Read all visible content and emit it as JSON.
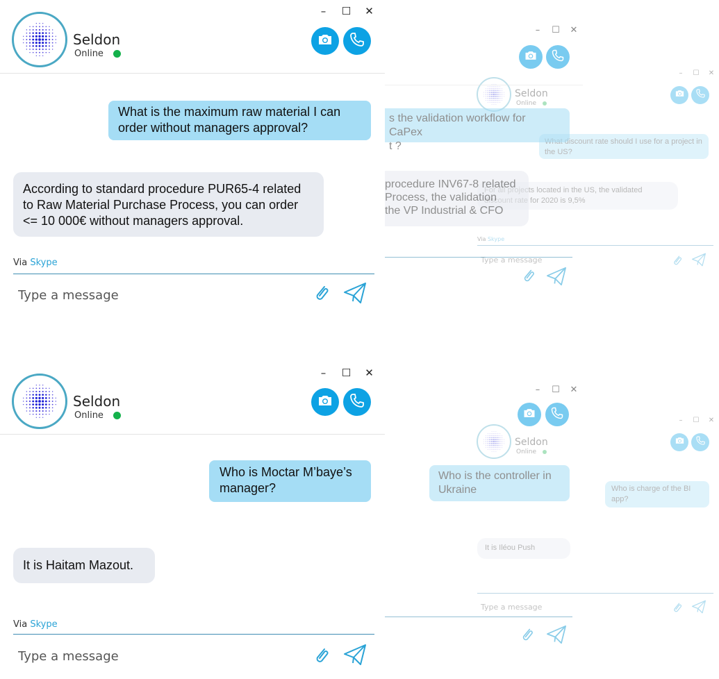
{
  "window_controls": {
    "minimize": "–",
    "maximize": "☐",
    "close": "✕"
  },
  "bot": {
    "name": "Seldon",
    "status": "Online"
  },
  "colors": {
    "call_button": "#0da2e4",
    "user_bubble": "#a5ddf5",
    "bot_bubble": "#e8ebf1",
    "online_dot": "#14b14b",
    "link": "#2aa3d6"
  },
  "icons": {
    "camera": "camera-icon",
    "phone": "phone-icon",
    "attach": "paperclip-icon",
    "send": "paper-plane-icon"
  },
  "via": {
    "prefix": "Via",
    "service": "Skype"
  },
  "input": {
    "placeholder": "Type a message"
  },
  "windows": [
    {
      "user_message": "What is the maximum raw material I can order without managers approval?",
      "bot_message": "According to standard procedure PUR65-4 related to Raw Material Purchase Process, you can order <= 10 000€ without managers approval."
    },
    {
      "user_message": "Who is Moctar M’baye’s manager?",
      "bot_message": "It is Haitam Mazout."
    }
  ],
  "background_windows": [
    {
      "user_message_fragment": "s the validation workflow for CaPex",
      "user_message_fragment2": "t ?",
      "bot_message_fragment1": "procedure INV67-8 related",
      "bot_message_fragment2": "Process, the validation",
      "bot_message_fragment3": "the VP Industrial & CFO"
    },
    {
      "user_message": "What discount rate should I use for a project in the US?",
      "bot_message": "For all projects located in the US, the validated discount rate for 2020 is 9,5%"
    },
    {
      "user_message": "Who is the controller in Ukraine"
    },
    {
      "user_message": "Who is charge of the BI app?",
      "bot_message": "It is Iléou Push"
    }
  ]
}
